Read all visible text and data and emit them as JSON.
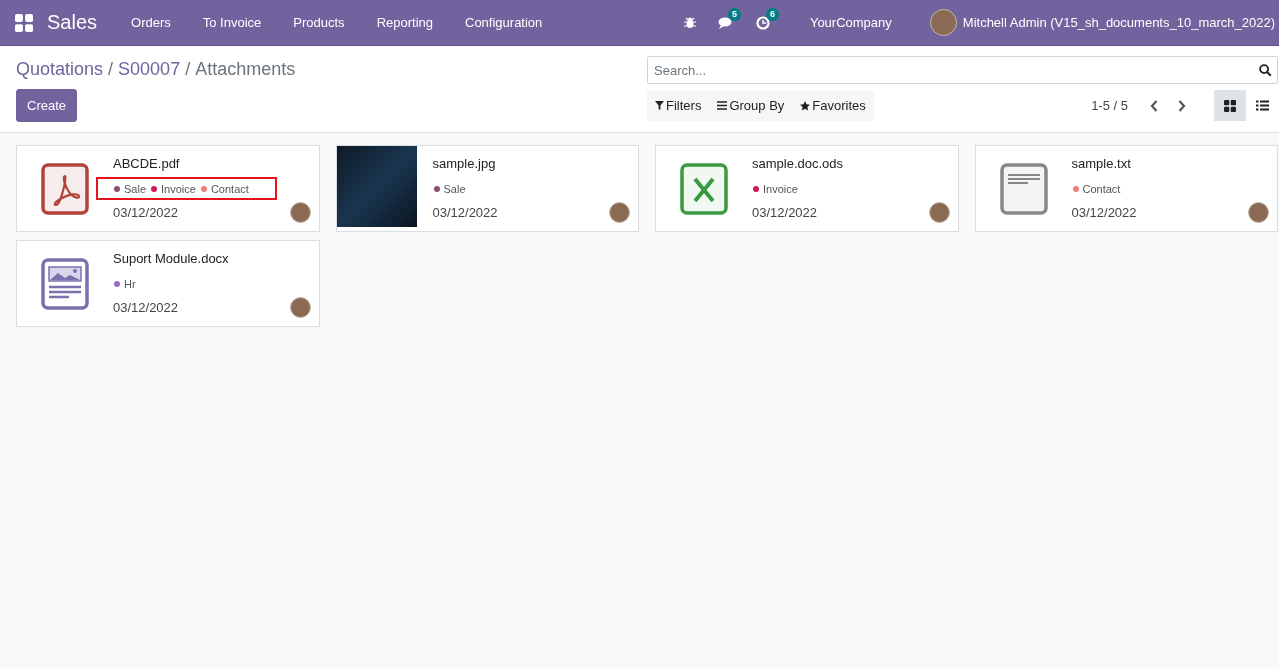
{
  "navbar": {
    "app": "Sales",
    "menu": [
      "Orders",
      "To Invoice",
      "Products",
      "Reporting",
      "Configuration"
    ],
    "messages_count": "5",
    "activities_count": "6",
    "company": "YourCompany",
    "user": "Mitchell Admin (V15_sh_documents_10_march_2022)"
  },
  "breadcrumb": [
    "Quotations",
    "S00007",
    "Attachments"
  ],
  "breadcrumb_separator": "/",
  "create_button": "Create",
  "search": {
    "placeholder": "Search..."
  },
  "filters": [
    "Filters",
    "Group By",
    "Favorites"
  ],
  "pager": "1-5 / 5",
  "views": [
    {
      "kind": "kanban",
      "selected": true
    },
    {
      "kind": "list",
      "selected": false
    }
  ],
  "cards": [
    {
      "kind": "pdf",
      "name": "ABCDE.pdf",
      "highlighted": true,
      "tags": [
        {
          "label": "Sale",
          "color": "#87506e"
        },
        {
          "label": "Invoice",
          "color": "#d6145f"
        },
        {
          "label": "Contact",
          "color": "#f07c7c"
        }
      ],
      "date": "03/12/2022"
    },
    {
      "kind": "image",
      "name": "sample.jpg",
      "highlighted": false,
      "tags": [
        {
          "label": "Sale",
          "color": "#87506e"
        }
      ],
      "date": "03/12/2022"
    },
    {
      "kind": "spreadsheet",
      "name": "sample.doc.ods",
      "highlighted": false,
      "tags": [
        {
          "label": "Invoice",
          "color": "#d6145f"
        }
      ],
      "date": "03/12/2022"
    },
    {
      "kind": "text",
      "name": "sample.txt",
      "highlighted": false,
      "tags": [
        {
          "label": "Contact",
          "color": "#f07c7c"
        }
      ],
      "date": "03/12/2022"
    },
    {
      "kind": "document",
      "name": "Suport Module.docx",
      "highlighted": false,
      "tags": [
        {
          "label": "Hr",
          "color": "#9b6bc9"
        }
      ],
      "date": "03/12/2022"
    }
  ]
}
